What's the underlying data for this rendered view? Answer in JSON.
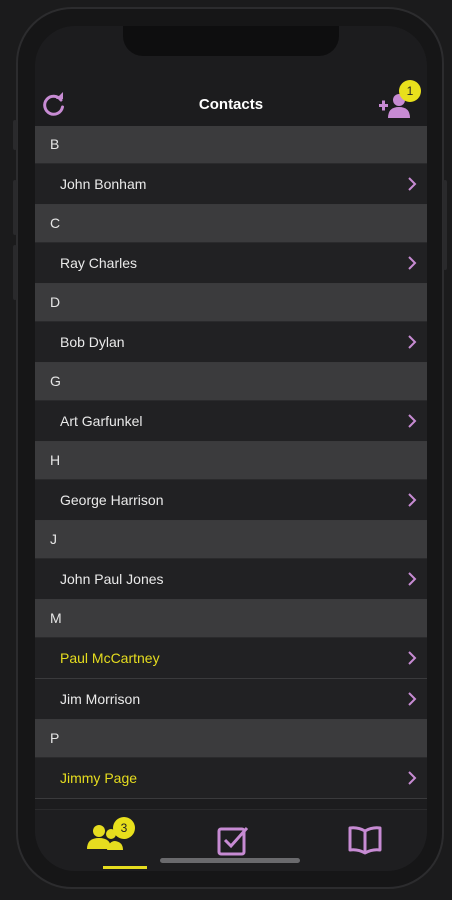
{
  "header": {
    "title": "Contacts",
    "add_badge": "1"
  },
  "sections": [
    {
      "letter": "B",
      "contacts": [
        {
          "name": "John Bonham",
          "highlighted": false
        }
      ]
    },
    {
      "letter": "C",
      "contacts": [
        {
          "name": "Ray Charles",
          "highlighted": false
        }
      ]
    },
    {
      "letter": "D",
      "contacts": [
        {
          "name": "Bob Dylan",
          "highlighted": false
        }
      ]
    },
    {
      "letter": "G",
      "contacts": [
        {
          "name": "Art Garfunkel",
          "highlighted": false
        }
      ]
    },
    {
      "letter": "H",
      "contacts": [
        {
          "name": "George Harrison",
          "highlighted": false
        }
      ]
    },
    {
      "letter": "J",
      "contacts": [
        {
          "name": "John Paul Jones",
          "highlighted": false
        }
      ]
    },
    {
      "letter": "M",
      "contacts": [
        {
          "name": "Paul McCartney",
          "highlighted": true
        },
        {
          "name": "Jim Morrison",
          "highlighted": false
        }
      ]
    },
    {
      "letter": "P",
      "contacts": [
        {
          "name": "Jimmy Page",
          "highlighted": true
        }
      ]
    }
  ],
  "tabbar": {
    "contacts_badge": "3",
    "active_tab": "contacts"
  },
  "icons": {
    "refresh": "refresh-icon",
    "add_contact": "add-contact-icon",
    "chevron": "chevron-right-icon",
    "tab_contacts": "people-icon",
    "tab_tasks": "checkbox-icon",
    "tab_book": "book-icon"
  },
  "colors": {
    "accent": "#e6dd1f",
    "icon": "#c78bd3",
    "section_bg": "#3b3b3d",
    "row_bg": "#212123"
  }
}
